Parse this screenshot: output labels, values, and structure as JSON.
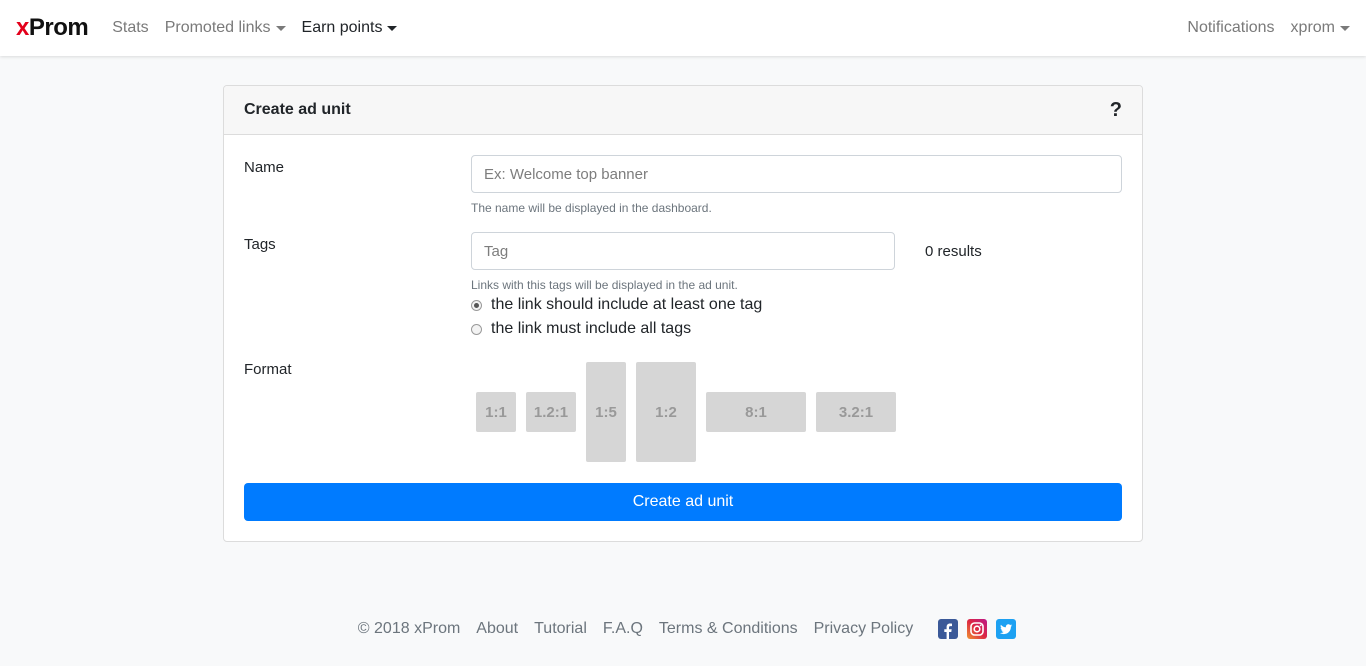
{
  "navbar": {
    "brand_x": "x",
    "brand_rest": "Prom",
    "links": [
      {
        "label": "Stats"
      },
      {
        "label": "Promoted links"
      },
      {
        "label": "Earn points"
      }
    ],
    "notifications": "Notifications",
    "user": "xprom"
  },
  "card": {
    "title": "Create ad unit",
    "help": "?",
    "name_label": "Name",
    "name_placeholder": "Ex: Welcome top banner",
    "name_help": "The name will be displayed in the dashboard.",
    "tags_label": "Tags",
    "tags_placeholder": "Tag",
    "tags_results": "0 results",
    "tags_help": "Links with this tags will be displayed in the ad unit.",
    "radio_any": "the link should include at least one tag",
    "radio_all": "the link must include all tags",
    "format_label": "Format",
    "formats": [
      "1:1",
      "1.2:1",
      "1:5",
      "1:2",
      "8:1",
      "3.2:1"
    ],
    "submit": "Create ad unit"
  },
  "footer": {
    "copyright": "© 2018 xProm",
    "links": [
      "About",
      "Tutorial",
      "F.A.Q",
      "Terms & Conditions",
      "Privacy Policy"
    ]
  },
  "colors": {
    "primary": "#007bff",
    "brand_red": "#e3001b",
    "facebook": "#3b5998",
    "twitter": "#1da1f2"
  }
}
